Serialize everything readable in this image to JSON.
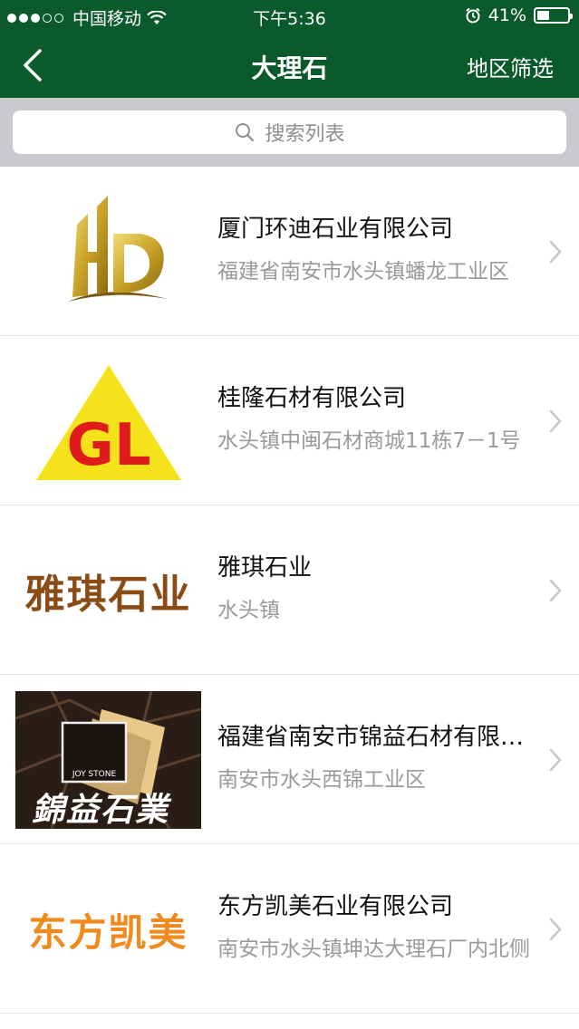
{
  "status": {
    "carrier": "中国移动",
    "time": "下午5:36",
    "battery": "41%",
    "battery_level": 0.41
  },
  "nav": {
    "title": "大理石",
    "filter_label": "地区筛选"
  },
  "search": {
    "placeholder": "搜索列表"
  },
  "companies": [
    {
      "name": "厦门环迪石业有限公司",
      "address": "福建省南安市水头镇蟠龙工业区",
      "logo": "hd-gold-logo"
    },
    {
      "name": "桂隆石材有限公司",
      "address": "水头镇中闽石材商城11栋7－1号",
      "logo_text": "GL"
    },
    {
      "name": "雅琪石业",
      "address": "水头镇",
      "logo_text": "雅琪石业"
    },
    {
      "name": "福建省南安市锦益石材有限公司",
      "address": "南安市水头西锦工业区",
      "logo_text": "錦益石業",
      "logo_badge": "JOY STONE"
    },
    {
      "name": "东方凯美石业有限公司",
      "address": "南安市水头镇坤达大理石厂内北侧",
      "logo_text": "东方凯美"
    }
  ],
  "colors": {
    "nav_bg": "#0b5a2c",
    "search_bg": "#c9c9ce"
  }
}
